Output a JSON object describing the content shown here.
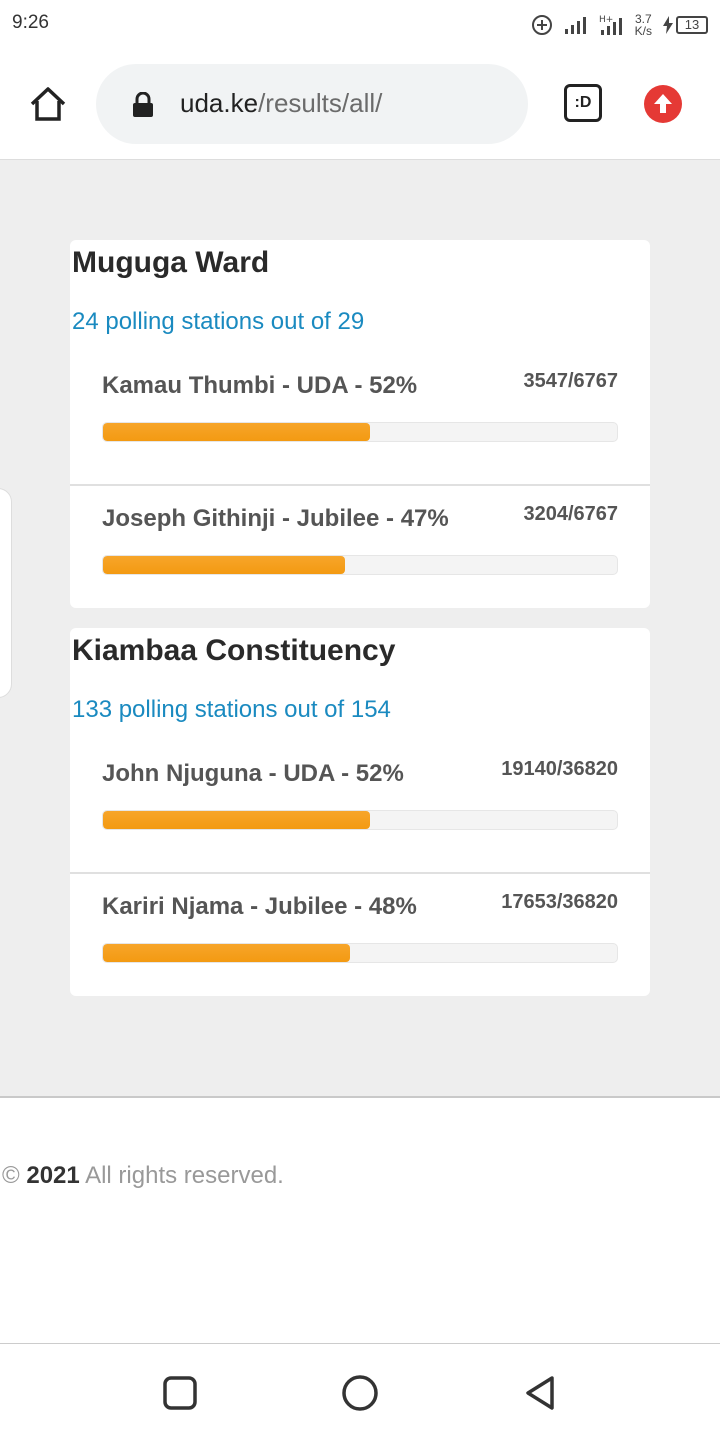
{
  "status_bar": {
    "time": "9:26",
    "net_speed_value": "3.7",
    "net_speed_unit": "K/s",
    "battery_level": "13"
  },
  "browser": {
    "url_domain": "uda.ke",
    "url_path": "/results/all/",
    "extension_label": ":D",
    "icons": [
      "home-icon",
      "lock-icon",
      "extension-icon",
      "upload-icon"
    ]
  },
  "results": [
    {
      "title": "Muguga Ward",
      "subtitle": "24 polling stations out of 29",
      "candidates": [
        {
          "label": "Kamau Thumbi - UDA - 52%",
          "votes_text": "3547/6767",
          "percent": 52
        },
        {
          "label": "Joseph Githinji - Jubilee - 47%",
          "votes_text": "3204/6767",
          "percent": 47
        }
      ]
    },
    {
      "title": "Kiambaa Constituency",
      "subtitle": "133 polling stations out of 154",
      "candidates": [
        {
          "label": "John Njuguna - UDA - 52%",
          "votes_text": "19140/36820",
          "percent": 52
        },
        {
          "label": "Kariri Njama - Jubilee - 48%",
          "votes_text": "17653/36820",
          "percent": 48
        }
      ]
    }
  ],
  "footer": {
    "copyright_symbol": "©",
    "year": "2021",
    "rights_text": "All rights reserved."
  },
  "colors": {
    "accent_link": "#1a8ac0",
    "progress_bar": "#f39a12",
    "upload_button": "#e53935"
  }
}
